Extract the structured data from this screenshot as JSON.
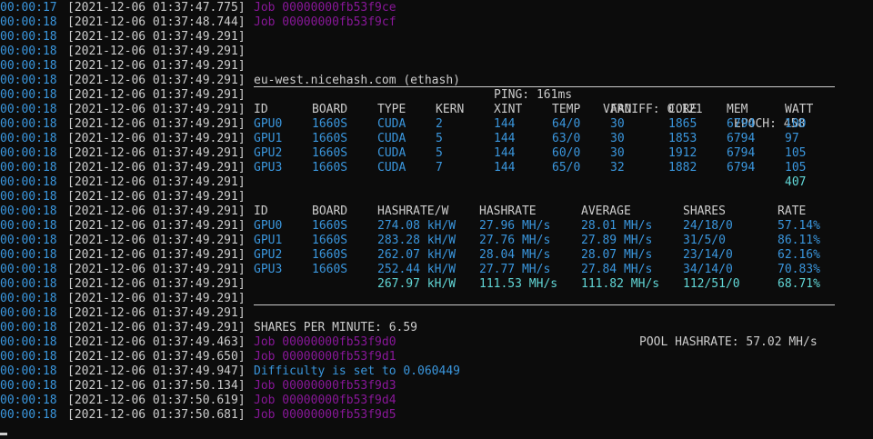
{
  "log_lines": [
    {
      "uptime": "00:00:17",
      "ts": "[2021-12-06 01:37:47.775]",
      "msg": "Job 00000000fb53f9ce",
      "kind": "job"
    },
    {
      "uptime": "00:00:18",
      "ts": "[2021-12-06 01:37:48.744]",
      "msg": "Job 00000000fb53f9cf",
      "kind": "job"
    },
    {
      "uptime": "00:00:18",
      "ts": "[2021-12-06 01:37:49.291]",
      "msg": "",
      "kind": "plain"
    },
    {
      "uptime": "00:00:18",
      "ts": "[2021-12-06 01:37:49.291]",
      "msg": "",
      "kind": "plain"
    },
    {
      "uptime": "00:00:18",
      "ts": "[2021-12-06 01:37:49.291]",
      "msg": "",
      "kind": "plain"
    },
    {
      "uptime": "00:00:18",
      "ts": "[2021-12-06 01:37:49.291]",
      "msg": "",
      "kind": "plain"
    },
    {
      "uptime": "00:00:18",
      "ts": "[2021-12-06 01:37:49.291]",
      "msg": "",
      "kind": "plain"
    },
    {
      "uptime": "00:00:18",
      "ts": "[2021-12-06 01:37:49.291]",
      "msg": "",
      "kind": "plain"
    },
    {
      "uptime": "00:00:18",
      "ts": "[2021-12-06 01:37:49.291]",
      "msg": "",
      "kind": "plain"
    },
    {
      "uptime": "00:00:18",
      "ts": "[2021-12-06 01:37:49.291]",
      "msg": "",
      "kind": "plain"
    },
    {
      "uptime": "00:00:18",
      "ts": "[2021-12-06 01:37:49.291]",
      "msg": "",
      "kind": "plain"
    },
    {
      "uptime": "00:00:18",
      "ts": "[2021-12-06 01:37:49.291]",
      "msg": "",
      "kind": "plain"
    },
    {
      "uptime": "00:00:18",
      "ts": "[2021-12-06 01:37:49.291]",
      "msg": "",
      "kind": "plain"
    },
    {
      "uptime": "00:00:18",
      "ts": "[2021-12-06 01:37:49.291]",
      "msg": "",
      "kind": "plain"
    },
    {
      "uptime": "00:00:18",
      "ts": "[2021-12-06 01:37:49.291]",
      "msg": "",
      "kind": "plain"
    },
    {
      "uptime": "00:00:18",
      "ts": "[2021-12-06 01:37:49.291]",
      "msg": "",
      "kind": "plain"
    },
    {
      "uptime": "00:00:18",
      "ts": "[2021-12-06 01:37:49.291]",
      "msg": "",
      "kind": "plain"
    },
    {
      "uptime": "00:00:18",
      "ts": "[2021-12-06 01:37:49.291]",
      "msg": "",
      "kind": "plain"
    },
    {
      "uptime": "00:00:18",
      "ts": "[2021-12-06 01:37:49.291]",
      "msg": "",
      "kind": "plain"
    },
    {
      "uptime": "00:00:18",
      "ts": "[2021-12-06 01:37:49.291]",
      "msg": "",
      "kind": "plain"
    },
    {
      "uptime": "00:00:18",
      "ts": "[2021-12-06 01:37:49.291]",
      "msg": "",
      "kind": "plain"
    },
    {
      "uptime": "00:00:18",
      "ts": "[2021-12-06 01:37:49.291]",
      "msg": "",
      "kind": "plain"
    },
    {
      "uptime": "00:00:18",
      "ts": "[2021-12-06 01:37:49.291]",
      "msg": "",
      "kind": "plain"
    },
    {
      "uptime": "00:00:18",
      "ts": "[2021-12-06 01:37:49.463]",
      "msg": "Job 00000000fb53f9d0",
      "kind": "job"
    },
    {
      "uptime": "00:00:18",
      "ts": "[2021-12-06 01:37:49.650]",
      "msg": "Job 00000000fb53f9d1",
      "kind": "job"
    },
    {
      "uptime": "00:00:18",
      "ts": "[2021-12-06 01:37:49.947]",
      "msg": "Difficulty is set to 0.060449",
      "kind": "diff"
    },
    {
      "uptime": "00:00:18",
      "ts": "[2021-12-06 01:37:50.134]",
      "msg": "Job 00000000fb53f9d3",
      "kind": "job"
    },
    {
      "uptime": "00:00:18",
      "ts": "[2021-12-06 01:37:50.619]",
      "msg": "Job 00000000fb53f9d4",
      "kind": "job"
    },
    {
      "uptime": "00:00:18",
      "ts": "[2021-12-06 01:37:50.681]",
      "msg": "Job 00000000fb53f9d5",
      "kind": "job"
    }
  ],
  "pool_info": {
    "server": "eu-west.nicehash.com (ethash)",
    "ping": "PING: 161ms",
    "vardiff": "VARDIFF: 0.121",
    "epoch": "EPOCH: 458"
  },
  "gpu_table": {
    "headers": [
      "ID",
      "BOARD",
      "TYPE",
      "KERN",
      "XINT",
      "TEMP",
      "FAN",
      "CORE",
      "MEM",
      "WATT"
    ],
    "rows": [
      [
        "GPU0",
        "1660S",
        "CUDA",
        "2",
        "144",
        "64/0",
        "30",
        "1865",
        "6794",
        "100"
      ],
      [
        "GPU1",
        "1660S",
        "CUDA",
        "5",
        "144",
        "63/0",
        "30",
        "1853",
        "6794",
        "97"
      ],
      [
        "GPU2",
        "1660S",
        "CUDA",
        "5",
        "144",
        "60/0",
        "30",
        "1912",
        "6794",
        "105"
      ],
      [
        "GPU3",
        "1660S",
        "CUDA",
        "7",
        "144",
        "65/0",
        "32",
        "1882",
        "6794",
        "105"
      ]
    ],
    "total_watt": "407"
  },
  "hash_table": {
    "headers": [
      "ID",
      "BOARD",
      "HASHRATE/W",
      "HASHRATE",
      "AVERAGE",
      "SHARES",
      "RATE"
    ],
    "rows": [
      [
        "GPU0",
        "1660S",
        "274.08 kH/W",
        "27.96 MH/s",
        "28.01 MH/s",
        "24/18/0",
        "57.14%"
      ],
      [
        "GPU1",
        "1660S",
        "283.28 kH/W",
        "27.76 MH/s",
        "27.89 MH/s",
        "31/5/0",
        "86.11%"
      ],
      [
        "GPU2",
        "1660S",
        "262.07 kH/W",
        "28.04 MH/s",
        "28.07 MH/s",
        "23/14/0",
        "62.16%"
      ],
      [
        "GPU3",
        "1660S",
        "252.44 kH/W",
        "27.77 MH/s",
        "27.84 MH/s",
        "34/14/0",
        "70.83%"
      ]
    ],
    "totals": [
      "267.97 kH/W",
      "111.53 MH/s",
      "111.82 MH/s",
      "112/51/0",
      "68.71%"
    ]
  },
  "summary": {
    "shares_per_minute": "SHARES PER MINUTE: 6.59",
    "pool_hashrate": "POOL HASHRATE: 57.02 MH/s"
  },
  "colors": {
    "background": "#0c0c0c",
    "text": "#cccccc",
    "uptime": "#3a96dd",
    "job": "#881798",
    "gpu_data": "#3a96dd",
    "totals": "#61d6d6"
  }
}
